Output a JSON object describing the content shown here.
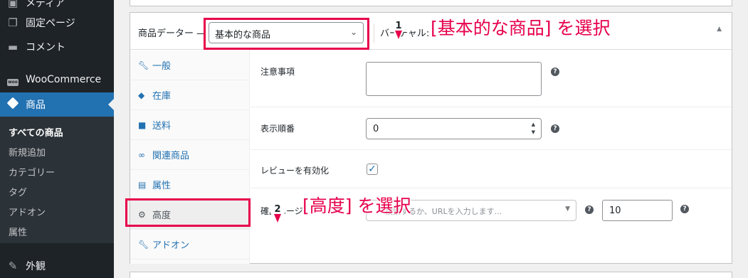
{
  "sidebar": {
    "items_top": [
      {
        "label": "メディア",
        "icon": "media-icon"
      },
      {
        "label": "固定ページ",
        "icon": "page-icon"
      },
      {
        "label": "コメント",
        "icon": "comment-icon"
      },
      {
        "label": "WooCommerce",
        "icon": "woo-icon"
      },
      {
        "label": "商品",
        "icon": "product-icon"
      }
    ],
    "submenu": [
      "すべての商品",
      "新規追加",
      "カテゴリー",
      "タグ",
      "アドオン",
      "属性"
    ],
    "items_bottom": [
      {
        "label": "外観",
        "icon": "appearance-icon"
      }
    ],
    "woo_badge": "woo"
  },
  "product_data": {
    "title": "商品データー —",
    "type_select_value": "基本的な商品",
    "virtual_label": "バーチャル:",
    "tabs": [
      {
        "label": "一般",
        "icon": "wrench-icon"
      },
      {
        "label": "在庫",
        "icon": "tag-icon"
      },
      {
        "label": "送料",
        "icon": "truck-icon"
      },
      {
        "label": "関連商品",
        "icon": "link-icon"
      },
      {
        "label": "属性",
        "icon": "list-icon"
      },
      {
        "label": "高度",
        "icon": "gear-icon"
      },
      {
        "label": "アドオン",
        "icon": "wrench-icon"
      }
    ],
    "fields": {
      "note_label": "注意事項",
      "order_label": "表示順番",
      "order_value": "0",
      "review_label": "レビューを有効化",
      "review_checked": true,
      "upsell_label": "確認ページ",
      "upsell_placeholder": "検索するか、URLを入力します...",
      "timeout_value": "10"
    }
  },
  "annotations": {
    "step1_number": "1",
    "step1_text": "[基本的な商品] を選択",
    "step2_number": "2",
    "step2_text": "[高度] を選択",
    "color": "#e6004c"
  },
  "colors": {
    "sidebar_bg": "#1d2327",
    "accent": "#2271b1"
  }
}
